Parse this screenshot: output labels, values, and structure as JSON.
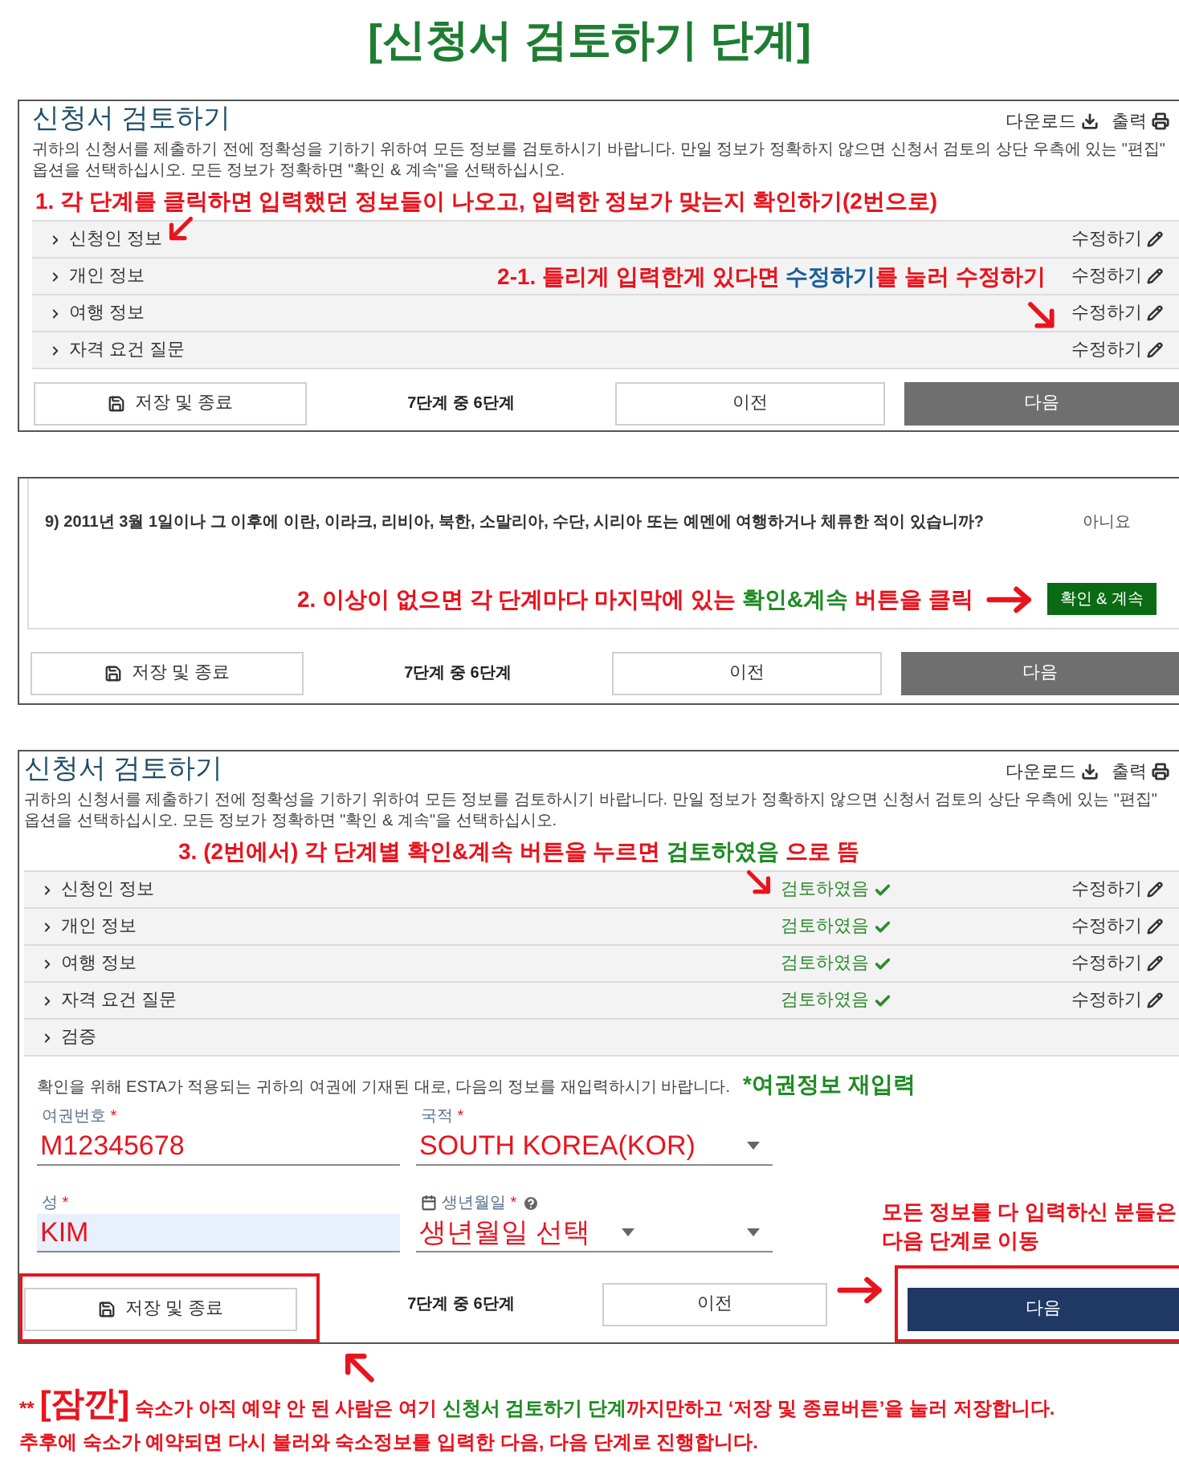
{
  "page_title": "[신청서 검토하기 단계]",
  "panels": [
    {
      "title": "신청서 검토하기",
      "download": "다운로드",
      "print": "출력",
      "description": "귀하의 신청서를 제출하기 전에 정확성을 기하기 위하여 모든 정보를 검토하시기 바랍니다. 만일 정보가 정확하지 않으면 신청서 검토의 상단 우측에 있는 \"편집\" 옵션을 선택하십시오. 모든 정보가 정확하면 \"확인 & 계속\"을 선택하십시오.",
      "callout": [
        {
          "text": "1. 각 단계를 클릭하면 입력했던 정보들이 나오고, 입력한 정보가 맞는지 확인하기(2번으로)",
          "color": "#e8141e"
        }
      ],
      "sections": [
        {
          "label": "신청인 정보",
          "edit": "수정하기",
          "label_arrow": true,
          "edit_arrow": false
        },
        {
          "label": "개인 정보",
          "edit": "수정하기",
          "label_arrow": false,
          "edit_arrow": false,
          "callout": [
            {
              "text": "2-1. 틀리게 입력한게 있다면 ",
              "color": "#e8141e"
            },
            {
              "text": "수정하기",
              "color": "#1b5e9b"
            },
            {
              "text": "를 눌러 수정하기",
              "color": "#e8141e"
            }
          ]
        },
        {
          "label": "여행 정보",
          "edit": "수정하기",
          "label_arrow": false,
          "edit_arrow": true
        },
        {
          "label": "자격 요건 질문",
          "edit": "수정하기",
          "label_arrow": false,
          "edit_arrow": false
        }
      ],
      "footer": {
        "save": "저장 및 종료",
        "progress": "7단계 중 6단계",
        "back": "이전",
        "next": "다음",
        "next_enabled": false,
        "highlighted": false
      }
    },
    {
      "question": {
        "text": "9) 2011년 3월 1일이나 그 이후에 이란, 이라크, 리비아, 북한, 소말리아, 수단, 시리아 또는 예멘에 여행하거나 체류한 적이 있습니까?",
        "answer": "아니요"
      },
      "confirm": {
        "callout": [
          {
            "text": "2. 이상이 없으면 각 단계마다 마지막에 있는 ",
            "color": "#e8141e"
          },
          {
            "text": "확인&계속",
            "color": "#1f8b24"
          },
          {
            "text": " 버튼을 클릭",
            "color": "#e8141e"
          }
        ],
        "button": "확인 & 계속"
      },
      "footer": {
        "save": "저장 및 종료",
        "progress": "7단계 중 6단계",
        "back": "이전",
        "next": "다음",
        "next_enabled": false,
        "highlighted": false
      }
    },
    {
      "title": "신청서 검토하기",
      "download": "다운로드",
      "print": "출력",
      "description": "귀하의 신청서를 제출하기 전에 정확성을 기하기 위하여 모든 정보를 검토하시기 바랍니다. 만일 정보가 정확하지 않으면 신청서 검토의 상단 우측에 있는 \"편집\" 옵션을 선택하십시오. 모든 정보가 정확하면 \"확인 & 계속\"을 선택하십시오.",
      "callout": [
        {
          "text": "3. (2번에서) 각 단계별 확인&계속 버튼을 누르면 ",
          "color": "#e8141e"
        },
        {
          "text": "검토하였음",
          "color": "#1f8b24"
        },
        {
          "text": " 으로 뜸",
          "color": "#e8141e"
        }
      ],
      "sections": [
        {
          "label": "신청인 정보",
          "status": "검토하였음",
          "edit": "수정하기",
          "status_arrow": true
        },
        {
          "label": "개인 정보",
          "status": "검토하였음",
          "edit": "수정하기",
          "status_arrow": false
        },
        {
          "label": "여행 정보",
          "status": "검토하였음",
          "edit": "수정하기",
          "status_arrow": false
        },
        {
          "label": "자격 요건 질문",
          "status": "검토하였음",
          "edit": "수정하기",
          "status_arrow": false
        },
        {
          "label": "검증",
          "status_arrow": false
        }
      ],
      "form": {
        "intro": "확인을 위해 ESTA가 적용되는 귀하의 여권에 기재된 대로, 다음의 정보를 재입력하시기 바랍니다.",
        "callout": [
          {
            "text": "*여권정보 재입력",
            "color": "#1f8b24"
          }
        ],
        "fields": [
          {
            "kind": "text",
            "label": "여권번호",
            "mark": "*",
            "value": "M12345678",
            "autofilled": false
          },
          {
            "kind": "select",
            "label": "국적",
            "mark": "*",
            "value": "SOUTH KOREA(KOR)",
            "autofilled": false
          },
          {
            "kind": "text",
            "label": "성",
            "mark": "*",
            "value": "KIM",
            "autofilled": true
          },
          {
            "kind": "date",
            "label": "생년월일",
            "mark": "*",
            "value": "생년월일 선택",
            "autofilled": false
          }
        ],
        "side_note": [
          "모든 정보를 다 입력하신 분들은",
          "다음 단계로 이동"
        ]
      },
      "footer": {
        "save": "저장 및 종료",
        "progress": "7단계 중 6단계",
        "back": "이전",
        "next": "다음",
        "next_enabled": true,
        "highlighted": true
      }
    }
  ],
  "note": [
    [
      {
        "text": "** ",
        "color": "#e8141e",
        "large": false
      },
      {
        "text": "[잠깐]",
        "color": "#e8141e",
        "large": true
      },
      {
        "text": " 숙소가 아직 예약 안 된 사람은 여기 ",
        "color": "#e8141e",
        "large": false
      },
      {
        "text": "신청서 검토하기 단계",
        "color": "#1f8b24",
        "large": false
      },
      {
        "text": "까지만하고 ‘저장 및 종료버튼’을 눌러 저장합니다.",
        "color": "#e8141e",
        "large": false
      }
    ],
    [
      {
        "text": "추후에 숙소가 예약되면 다시 불러와 숙소정보를 입력한 다음, 다음 단계로 진행합니다.",
        "color": "#e8141e",
        "large": false
      }
    ]
  ]
}
